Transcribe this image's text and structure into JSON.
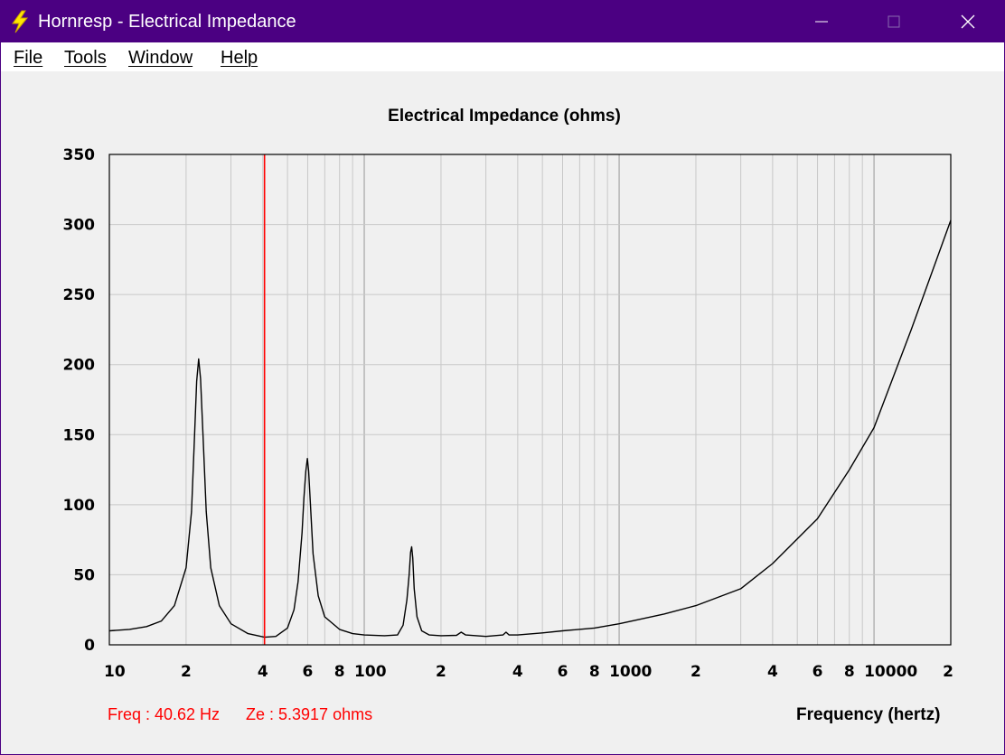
{
  "window": {
    "title": "Hornresp - Electrical Impedance",
    "icon": "lightning-bolt-icon",
    "controls": [
      "minimize-icon",
      "maximize-icon",
      "close-icon"
    ]
  },
  "menu": {
    "items": [
      {
        "label": "File"
      },
      {
        "label": "Tools"
      },
      {
        "label": "Window"
      },
      {
        "label": "Help"
      }
    ]
  },
  "readout": {
    "freq": "Freq : 40.62 Hz",
    "ze": "Ze : 5.3917 ohms"
  },
  "colors": {
    "titlebar": "#4b0082",
    "curve": "#000000",
    "cursor": "#ff0000",
    "grid": "#c8c8c8"
  },
  "chart_data": {
    "type": "line",
    "title": "Electrical Impedance (ohms)",
    "xlabel": "Frequency (hertz)",
    "ylabel": "",
    "x_scale": "log",
    "xlim": [
      10,
      20000
    ],
    "ylim": [
      0,
      350
    ],
    "grid": true,
    "yticks": [
      0,
      50,
      100,
      150,
      200,
      250,
      300,
      350
    ],
    "xtick_labels": [
      {
        "value": 10,
        "label": "10"
      },
      {
        "value": 20,
        "label": "2"
      },
      {
        "value": 40,
        "label": "4"
      },
      {
        "value": 60,
        "label": "6"
      },
      {
        "value": 80,
        "label": "8"
      },
      {
        "value": 100,
        "label": "100"
      },
      {
        "value": 200,
        "label": "2"
      },
      {
        "value": 400,
        "label": "4"
      },
      {
        "value": 600,
        "label": "6"
      },
      {
        "value": 800,
        "label": "8"
      },
      {
        "value": 1000,
        "label": "1000"
      },
      {
        "value": 2000,
        "label": "2"
      },
      {
        "value": 4000,
        "label": "4"
      },
      {
        "value": 6000,
        "label": "6"
      },
      {
        "value": 8000,
        "label": "8"
      },
      {
        "value": 10000,
        "label": "10000"
      },
      {
        "value": 20000,
        "label": "2"
      }
    ],
    "cursor_x": 40.62,
    "series": [
      {
        "points": [
          [
            10,
            10
          ],
          [
            12,
            11
          ],
          [
            14,
            13
          ],
          [
            16,
            17
          ],
          [
            18,
            28
          ],
          [
            20,
            55
          ],
          [
            21,
            95
          ],
          [
            21.6,
            150
          ],
          [
            22,
            188
          ],
          [
            22.4,
            204
          ],
          [
            22.8,
            190
          ],
          [
            23.3,
            150
          ],
          [
            24,
            95
          ],
          [
            25,
            55
          ],
          [
            27,
            28
          ],
          [
            30,
            15
          ],
          [
            35,
            8
          ],
          [
            40.62,
            5.4
          ],
          [
            45,
            6
          ],
          [
            50,
            12
          ],
          [
            53,
            25
          ],
          [
            55,
            45
          ],
          [
            57,
            80
          ],
          [
            58,
            105
          ],
          [
            59,
            124
          ],
          [
            59.8,
            133
          ],
          [
            60.5,
            124
          ],
          [
            61.5,
            100
          ],
          [
            63,
            65
          ],
          [
            66,
            35
          ],
          [
            70,
            20
          ],
          [
            80,
            11
          ],
          [
            90,
            8
          ],
          [
            100,
            7
          ],
          [
            120,
            6.5
          ],
          [
            135,
            7
          ],
          [
            142,
            14
          ],
          [
            147,
            32
          ],
          [
            150,
            50
          ],
          [
            152,
            66
          ],
          [
            153.5,
            70
          ],
          [
            155,
            62
          ],
          [
            157,
            40
          ],
          [
            161,
            20
          ],
          [
            168,
            10
          ],
          [
            180,
            7
          ],
          [
            200,
            6.5
          ],
          [
            230,
            6.8
          ],
          [
            240,
            9
          ],
          [
            250,
            7
          ],
          [
            300,
            6
          ],
          [
            350,
            7
          ],
          [
            360,
            9
          ],
          [
            370,
            7
          ],
          [
            400,
            7
          ],
          [
            500,
            8.5
          ],
          [
            600,
            10
          ],
          [
            800,
            12
          ],
          [
            1000,
            15
          ],
          [
            1500,
            22
          ],
          [
            2000,
            28
          ],
          [
            3000,
            40
          ],
          [
            4000,
            58
          ],
          [
            6000,
            90
          ],
          [
            8000,
            125
          ],
          [
            10000,
            155
          ],
          [
            14000,
            225
          ],
          [
            20000,
            303
          ]
        ]
      }
    ]
  }
}
